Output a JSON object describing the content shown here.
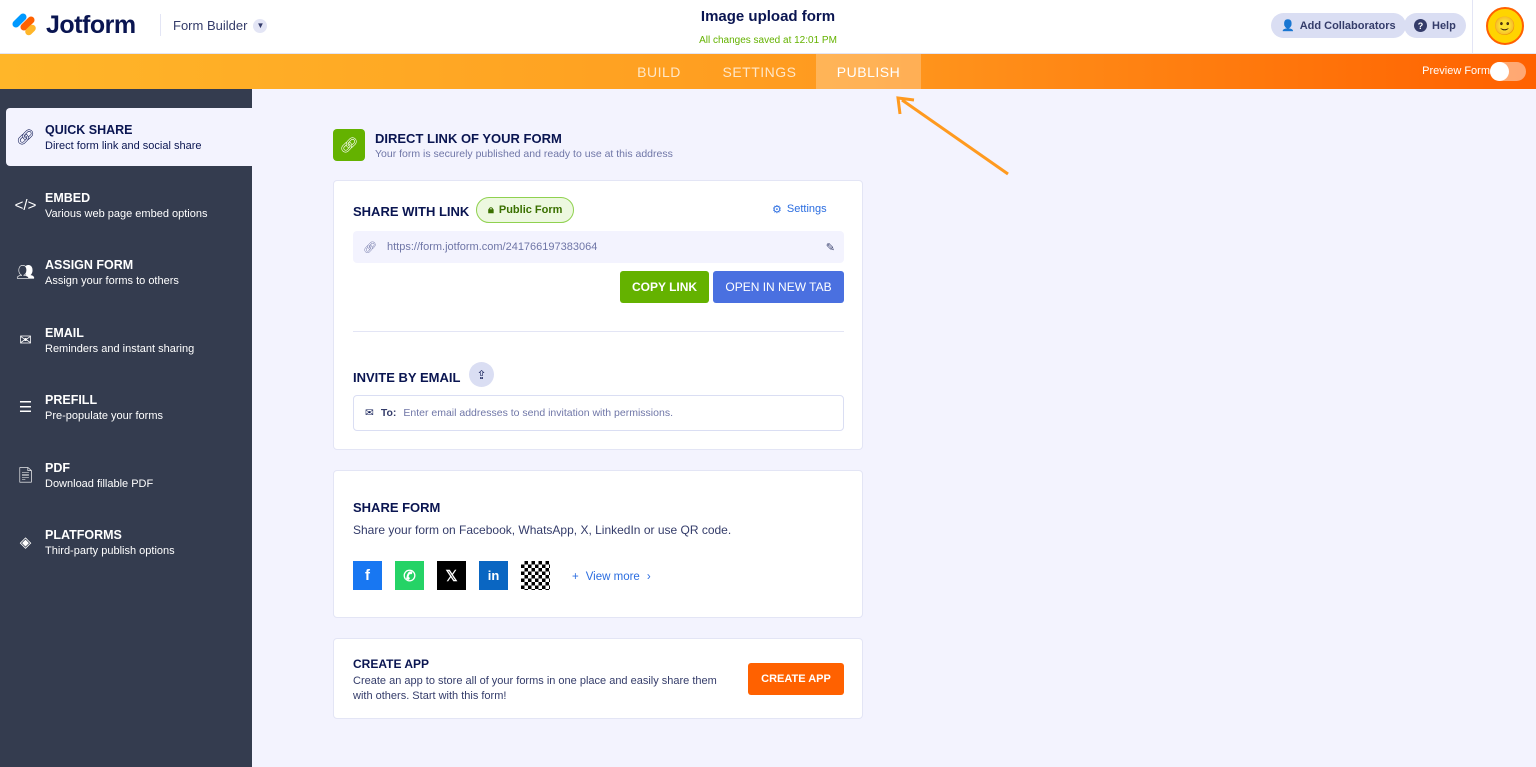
{
  "header": {
    "brand": "Jotform",
    "builder": "Form Builder",
    "title": "Image upload form",
    "saved": "All changes saved at 12:01 PM",
    "add_collaborators": "Add Collaborators",
    "help": "Help"
  },
  "tabs": [
    {
      "label": "BUILD"
    },
    {
      "label": "SETTINGS"
    },
    {
      "label": "PUBLISH"
    }
  ],
  "preview_form": {
    "label": "Preview Form",
    "on": false
  },
  "sidebar": [
    {
      "title": "QUICK SHARE",
      "desc": "Direct form link and social share",
      "icon": "link-icon"
    },
    {
      "title": "EMBED",
      "desc": "Various web page embed options",
      "icon": "code-icon"
    },
    {
      "title": "ASSIGN FORM",
      "desc": "Assign your forms to others",
      "icon": "users-icon"
    },
    {
      "title": "EMAIL",
      "desc": "Reminders and instant sharing",
      "icon": "envelope-icon"
    },
    {
      "title": "PREFILL",
      "desc": "Pre-populate your forms",
      "icon": "prefill-icon"
    },
    {
      "title": "PDF",
      "desc": "Download fillable PDF",
      "icon": "pdf-icon"
    },
    {
      "title": "PLATFORMS",
      "desc": "Third-party publish options",
      "icon": "layers-icon"
    }
  ],
  "direct": {
    "title": "DIRECT LINK OF YOUR FORM",
    "desc": "Your form is securely published and ready to use at this address"
  },
  "share_link": {
    "title": "SHARE WITH LINK",
    "badge": "Public Form",
    "settings": "Settings",
    "url": "https://form.jotform.com/241766197383064",
    "copy": "COPY LINK",
    "open": "OPEN IN NEW TAB"
  },
  "invite": {
    "title": "INVITE BY EMAIL",
    "to": "To:",
    "placeholder": "Enter email addresses to send invitation with permissions."
  },
  "share_form": {
    "title": "SHARE FORM",
    "desc": "Share your form on Facebook, WhatsApp, X, LinkedIn or use QR code.",
    "view_more": "View more"
  },
  "create_app": {
    "title": "CREATE APP",
    "desc": "Create an app to store all of your forms in one place and easily share them with others. Start with this form!",
    "button": "CREATE APP"
  },
  "colors": {
    "orange": "#ff6100",
    "green": "#64b200",
    "blue": "#4a70e0",
    "sidebar": "#343c4f"
  }
}
